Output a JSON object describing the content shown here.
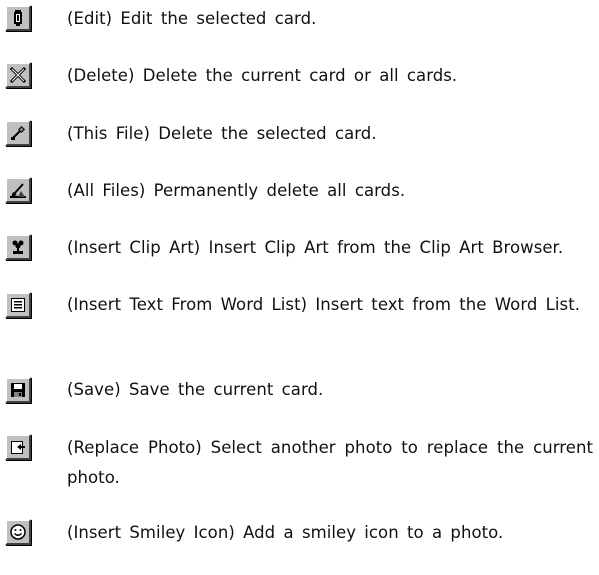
{
  "items": [
    {
      "icon": "edit-icon",
      "text": "(Edit) Edit the selected card."
    },
    {
      "icon": "delete-icon",
      "text": "(Delete) Delete the current card or all cards."
    },
    {
      "icon": "delete-this-file-icon",
      "text": "(This File) Delete the selected card."
    },
    {
      "icon": "delete-all-files-icon",
      "text": "(All Files) Permanently delete all cards."
    },
    {
      "icon": "insert-clip-art-icon",
      "text": "(Insert Clip Art) Insert Clip Art from the Clip Art Browser."
    },
    {
      "icon": "insert-text-from-word-list-icon",
      "text": "(Insert Text From Word List) Insert text from the Word List."
    },
    {
      "icon": "save-icon",
      "text": "(Save) Save the current card."
    },
    {
      "icon": "replace-photo-icon",
      "text": "(Replace Photo) Select another photo to replace the current photo."
    },
    {
      "icon": "insert-smiley-icon",
      "text": "(Insert Smiley Icon) Add a smiley icon to a photo."
    }
  ]
}
